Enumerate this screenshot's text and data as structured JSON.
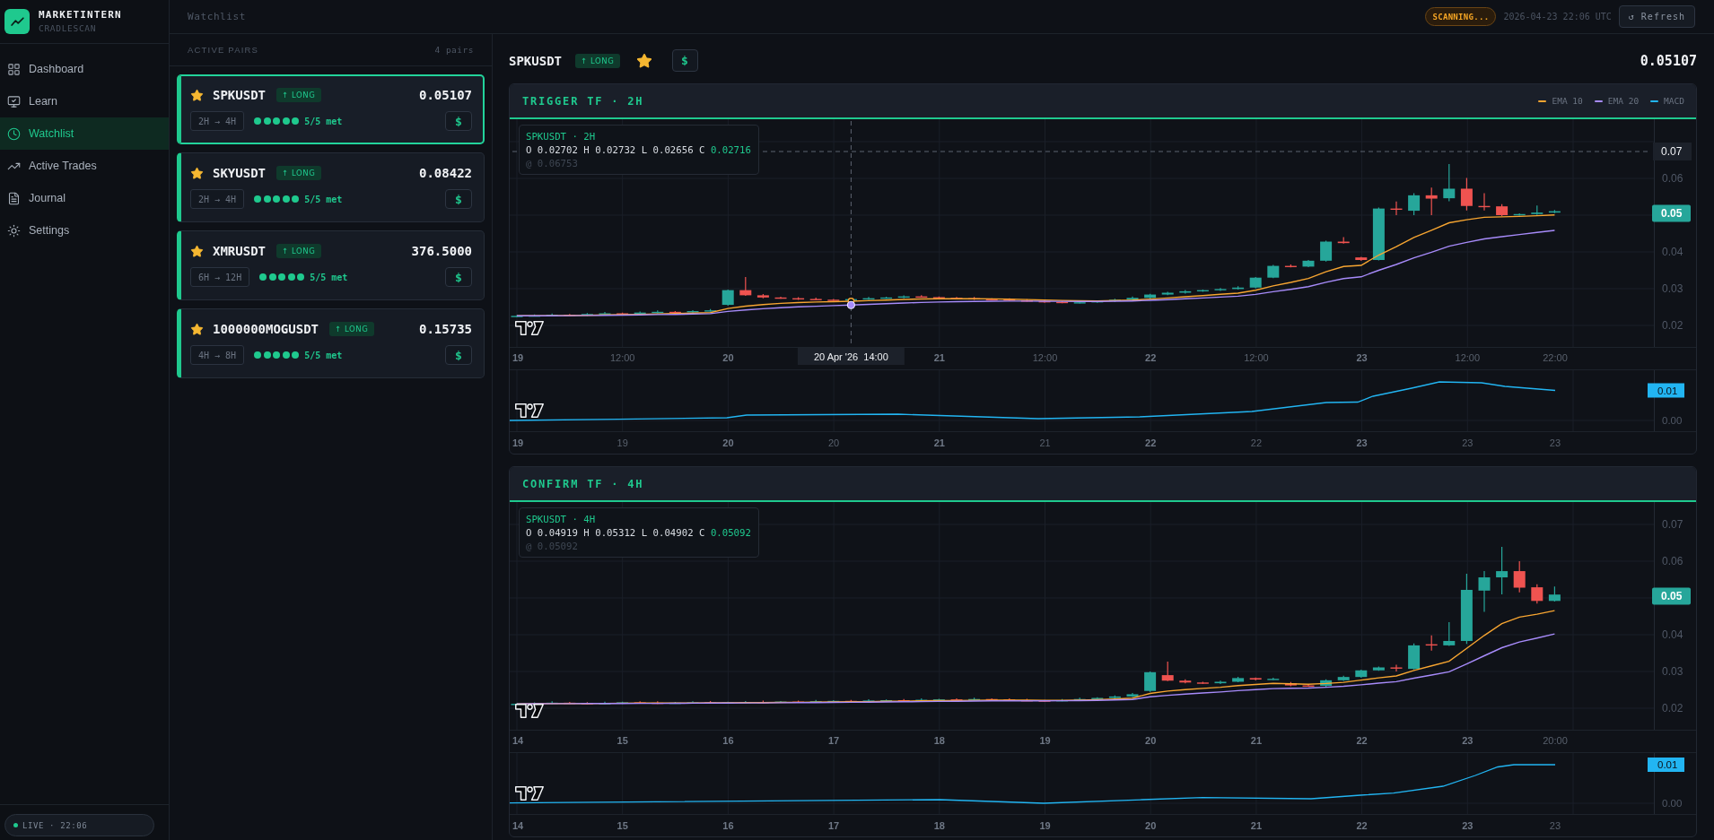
{
  "brand": {
    "name": "MARKETINTERN",
    "subtitle": "CRADLESCAN"
  },
  "sidebar": {
    "items": [
      {
        "label": "Dashboard",
        "selected": false
      },
      {
        "label": "Learn",
        "selected": false
      },
      {
        "label": "Watchlist",
        "selected": true
      },
      {
        "label": "Active Trades",
        "selected": false
      },
      {
        "label": "Journal",
        "selected": false
      },
      {
        "label": "Settings",
        "selected": false
      }
    ],
    "status": {
      "label": "LIVE · 22:06",
      "live": true
    }
  },
  "topbar": {
    "title": "Watchlist",
    "scan_status": "SCANNING...",
    "timestamp": "2026-04-23 22:06 UTC",
    "refresh_button": "↺ Refresh"
  },
  "watchlist": {
    "heading": "ACTIVE PAIRS",
    "count": "4 pairs",
    "pairs": [
      {
        "symbol": "SPKUSDT",
        "direction": "↑ LONG",
        "price": "0.05107",
        "timeframes": "2H → 4H",
        "conditions": [
          {
            "met": true
          },
          {
            "met": true
          },
          {
            "met": true
          },
          {
            "met": true
          },
          {
            "met": true
          }
        ],
        "score": "5/5 met",
        "starred": true,
        "selected": true,
        "trade_button": "$"
      },
      {
        "symbol": "SKYUSDT",
        "direction": "↑ LONG",
        "price": "0.08422",
        "timeframes": "2H → 4H",
        "conditions": [
          {
            "met": true
          },
          {
            "met": true
          },
          {
            "met": true
          },
          {
            "met": true
          },
          {
            "met": true
          }
        ],
        "score": "5/5 met",
        "starred": true,
        "selected": false,
        "trade_button": "$"
      },
      {
        "symbol": "XMRUSDT",
        "direction": "↑ LONG",
        "price": "376.5000",
        "timeframes": "6H → 12H",
        "conditions": [
          {
            "met": true
          },
          {
            "met": true
          },
          {
            "met": true
          },
          {
            "met": true
          },
          {
            "met": true
          }
        ],
        "score": "5/5 met",
        "starred": true,
        "selected": false,
        "trade_button": "$"
      },
      {
        "symbol": "1000000MOGUSDT",
        "direction": "↑ LONG",
        "price": "0.15735",
        "timeframes": "4H → 8H",
        "conditions": [
          {
            "met": true
          },
          {
            "met": true
          },
          {
            "met": true
          },
          {
            "met": true
          },
          {
            "met": true
          }
        ],
        "score": "5/5 met",
        "starred": true,
        "selected": false,
        "trade_button": "$"
      }
    ]
  },
  "detail": {
    "symbol": "SPKUSDT",
    "direction": "↑ LONG",
    "starred": true,
    "trade_button": "$",
    "price": "0.05107",
    "charts": [
      {
        "title": "TRIGGER TF · 2H",
        "legend": [
          {
            "label": "EMA 10",
            "color": "#f7a531"
          },
          {
            "label": "EMA 20",
            "color": "#a78bfa"
          },
          {
            "label": "MACD",
            "color": "#22b5f2"
          }
        ],
        "tooltip": {
          "title": "SPKUSDT · 2H",
          "ohlc": "O 0.02702 H 0.02732 L 0.02656 C",
          "close": "0.02716",
          "cursor_value": "@ 0.06753"
        },
        "price_ticks": [
          "0.06",
          "0.04",
          "0.03",
          "0.02"
        ],
        "last_price": "0.05",
        "crosshair": {
          "price": "0.07",
          "time": "20 Apr '26  14:00"
        },
        "time_axis": [
          {
            "label": "19",
            "kind": "major"
          },
          {
            "label": "12:00",
            "kind": "minor"
          },
          {
            "label": "20",
            "kind": "major"
          },
          {
            "label": "21",
            "kind": "major"
          },
          {
            "label": "12:00",
            "kind": "minor"
          },
          {
            "label": "22",
            "kind": "major"
          },
          {
            "label": "12:00",
            "kind": "minor"
          },
          {
            "label": "23",
            "kind": "major"
          },
          {
            "label": "12:00",
            "kind": "minor"
          },
          {
            "label": "22:00",
            "kind": "minor"
          }
        ],
        "macd_value": "0.01",
        "macd_ticks": [
          "0.00"
        ],
        "macd_axis": [
          {
            "label": "19",
            "kind": "major"
          },
          {
            "label": "19",
            "kind": "minor"
          },
          {
            "label": "20",
            "kind": "major"
          },
          {
            "label": "20",
            "kind": "minor"
          },
          {
            "label": "21",
            "kind": "major"
          },
          {
            "label": "21",
            "kind": "minor"
          },
          {
            "label": "22",
            "kind": "major"
          },
          {
            "label": "22",
            "kind": "minor"
          },
          {
            "label": "23",
            "kind": "major"
          },
          {
            "label": "23",
            "kind": "minor"
          },
          {
            "label": "23",
            "kind": "minor"
          }
        ]
      },
      {
        "title": "CONFIRM TF · 4H",
        "tooltip": {
          "title": "SPKUSDT · 4H",
          "ohlc": "O 0.04919 H 0.05312 L 0.04902 C",
          "close": "0.05092",
          "cursor_value": "@ 0.05092"
        },
        "price_ticks": [
          "0.07",
          "0.06",
          "0.04",
          "0.03",
          "0.02"
        ],
        "last_price": "0.05",
        "time_axis": [
          {
            "label": "14",
            "kind": "major"
          },
          {
            "label": "15",
            "kind": "major"
          },
          {
            "label": "16",
            "kind": "major"
          },
          {
            "label": "17",
            "kind": "major"
          },
          {
            "label": "18",
            "kind": "major"
          },
          {
            "label": "19",
            "kind": "major"
          },
          {
            "label": "20",
            "kind": "major"
          },
          {
            "label": "21",
            "kind": "major"
          },
          {
            "label": "22",
            "kind": "major"
          },
          {
            "label": "23",
            "kind": "major"
          },
          {
            "label": "20:00",
            "kind": "minor"
          }
        ],
        "macd_value": "0.01",
        "macd_ticks": [
          "0.00"
        ],
        "macd_axis": [
          {
            "label": "14",
            "kind": "major"
          },
          {
            "label": "15",
            "kind": "major"
          },
          {
            "label": "16",
            "kind": "major"
          },
          {
            "label": "17",
            "kind": "major"
          },
          {
            "label": "18",
            "kind": "major"
          },
          {
            "label": "19",
            "kind": "major"
          },
          {
            "label": "20",
            "kind": "major"
          },
          {
            "label": "21",
            "kind": "major"
          },
          {
            "label": "22",
            "kind": "major"
          },
          {
            "label": "23",
            "kind": "major"
          },
          {
            "label": "23",
            "kind": "minor"
          }
        ]
      }
    ]
  }
}
